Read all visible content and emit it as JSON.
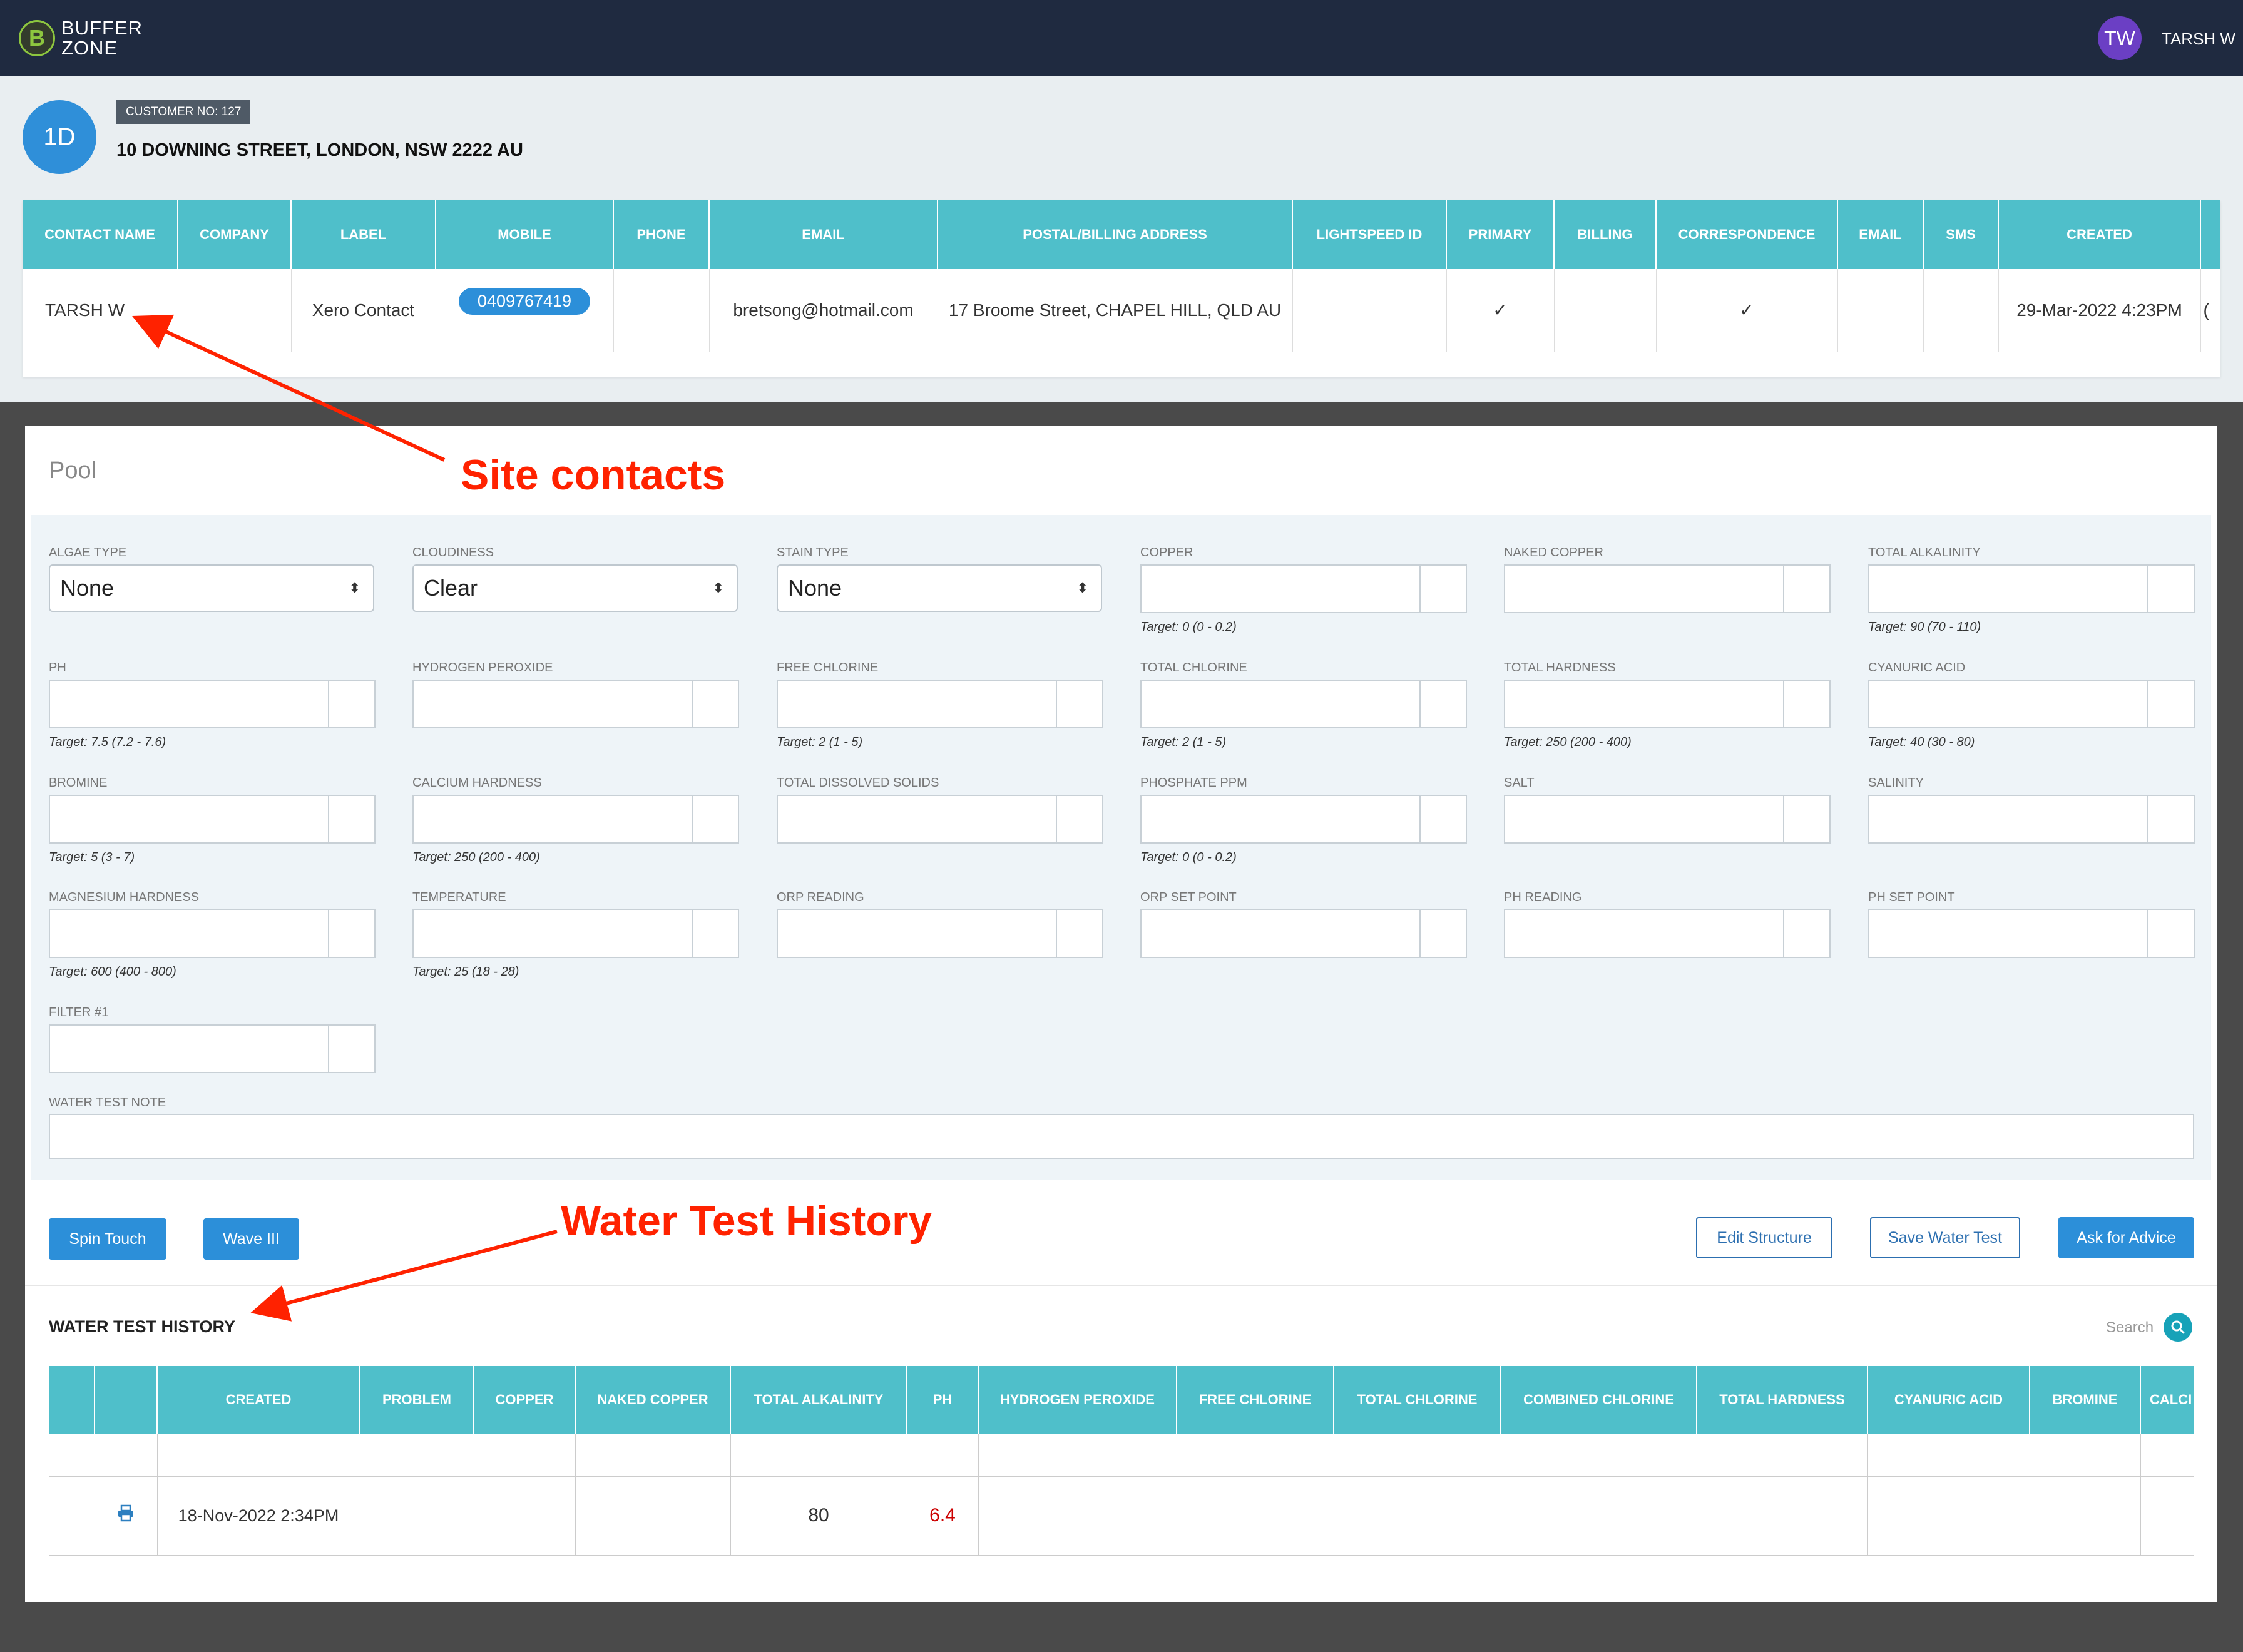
{
  "brand": {
    "line1": "BUFFER",
    "line2": "ZONE"
  },
  "user": {
    "initials": "TW",
    "name": "TARSH W"
  },
  "customer": {
    "initials": "1D",
    "badge": "CUSTOMER NO: 127",
    "address": "10 DOWNING STREET, LONDON, NSW 2222 AU"
  },
  "contacts": {
    "headers": [
      "CONTACT NAME",
      "COMPANY",
      "LABEL",
      "MOBILE",
      "PHONE",
      "EMAIL",
      "POSTAL/BILLING ADDRESS",
      "LIGHTSPEED ID",
      "PRIMARY",
      "BILLING",
      "CORRESPONDENCE",
      "EMAIL",
      "SMS",
      "CREATED"
    ],
    "row": {
      "contact_name": "TARSH W",
      "company": "",
      "label": "Xero Contact",
      "mobile": "0409767419",
      "phone": "",
      "email": "bretsong@hotmail.com",
      "address": "17 Broome Street, CHAPEL HILL, QLD AU",
      "lightspeed_id": "",
      "primary": "✓",
      "billing": "",
      "correspondence": "✓",
      "email_flag": "",
      "sms": "",
      "created": "29-Mar-2022 4:23PM",
      "overflow": "("
    }
  },
  "pool": {
    "title": "Pool",
    "selects": {
      "algae_type": {
        "label": "ALGAE TYPE",
        "value": "None"
      },
      "cloudiness": {
        "label": "CLOUDINESS",
        "value": "Clear"
      },
      "stain_type": {
        "label": "STAIN TYPE",
        "value": "None"
      }
    },
    "fields": {
      "copper": {
        "label": "COPPER",
        "target": "Target: 0 (0 - 0.2)"
      },
      "naked_copper": {
        "label": "NAKED COPPER",
        "target": ""
      },
      "total_alkalinity": {
        "label": "TOTAL ALKALINITY",
        "target": "Target: 90 (70 - 110)"
      },
      "ph": {
        "label": "PH",
        "target": "Target: 7.5 (7.2 - 7.6)"
      },
      "hydrogen_peroxide": {
        "label": "HYDROGEN PEROXIDE",
        "target": ""
      },
      "free_chlorine": {
        "label": "FREE CHLORINE",
        "target": "Target: 2 (1 - 5)"
      },
      "total_chlorine": {
        "label": "TOTAL CHLORINE",
        "target": "Target: 2 (1 - 5)"
      },
      "total_hardness": {
        "label": "TOTAL HARDNESS",
        "target": "Target: 250 (200 - 400)"
      },
      "cyanuric_acid": {
        "label": "CYANURIC ACID",
        "target": "Target: 40 (30 - 80)"
      },
      "bromine": {
        "label": "BROMINE",
        "target": "Target: 5 (3 - 7)"
      },
      "calcium_hardness": {
        "label": "CALCIUM HARDNESS",
        "target": "Target: 250 (200 - 400)"
      },
      "tds": {
        "label": "TOTAL DISSOLVED SOLIDS",
        "target": ""
      },
      "phosphate": {
        "label": "PHOSPHATE PPM",
        "target": "Target: 0 (0 - 0.2)"
      },
      "salt": {
        "label": "SALT",
        "target": ""
      },
      "salinity": {
        "label": "SALINITY",
        "target": ""
      },
      "magnesium_hardness": {
        "label": "MAGNESIUM HARDNESS",
        "target": "Target: 600 (400 - 800)"
      },
      "temperature": {
        "label": "TEMPERATURE",
        "target": "Target: 25 (18 - 28)"
      },
      "orp_reading": {
        "label": "ORP READING",
        "target": ""
      },
      "orp_set_point": {
        "label": "ORP SET POINT",
        "target": ""
      },
      "ph_reading": {
        "label": "PH READING",
        "target": ""
      },
      "ph_set_point": {
        "label": "PH SET POINT",
        "target": ""
      },
      "filter_1": {
        "label": "FILTER #1",
        "target": ""
      }
    },
    "note_label": "WATER TEST NOTE"
  },
  "buttons": {
    "spin_touch": "Spin Touch",
    "wave": "Wave III",
    "edit_structure": "Edit Structure",
    "save_water_test": "Save Water Test",
    "ask_advice": "Ask for Advice"
  },
  "history": {
    "title": "WATER TEST HISTORY",
    "search_label": "Search",
    "headers": [
      "",
      "",
      "CREATED",
      "PROBLEM",
      "COPPER",
      "NAKED COPPER",
      "TOTAL ALKALINITY",
      "PH",
      "HYDROGEN PEROXIDE",
      "FREE CHLORINE",
      "TOTAL CHLORINE",
      "COMBINED CHLORINE",
      "TOTAL HARDNESS",
      "CYANURIC ACID",
      "BROMINE",
      "CALCI"
    ],
    "row": {
      "created": "18-Nov-2022 2:34PM",
      "total_alkalinity": "80",
      "ph": "6.4"
    }
  },
  "annotations": {
    "site_contacts": "Site contacts",
    "water_test_history": "Water Test History",
    "color": "#ff2200"
  }
}
